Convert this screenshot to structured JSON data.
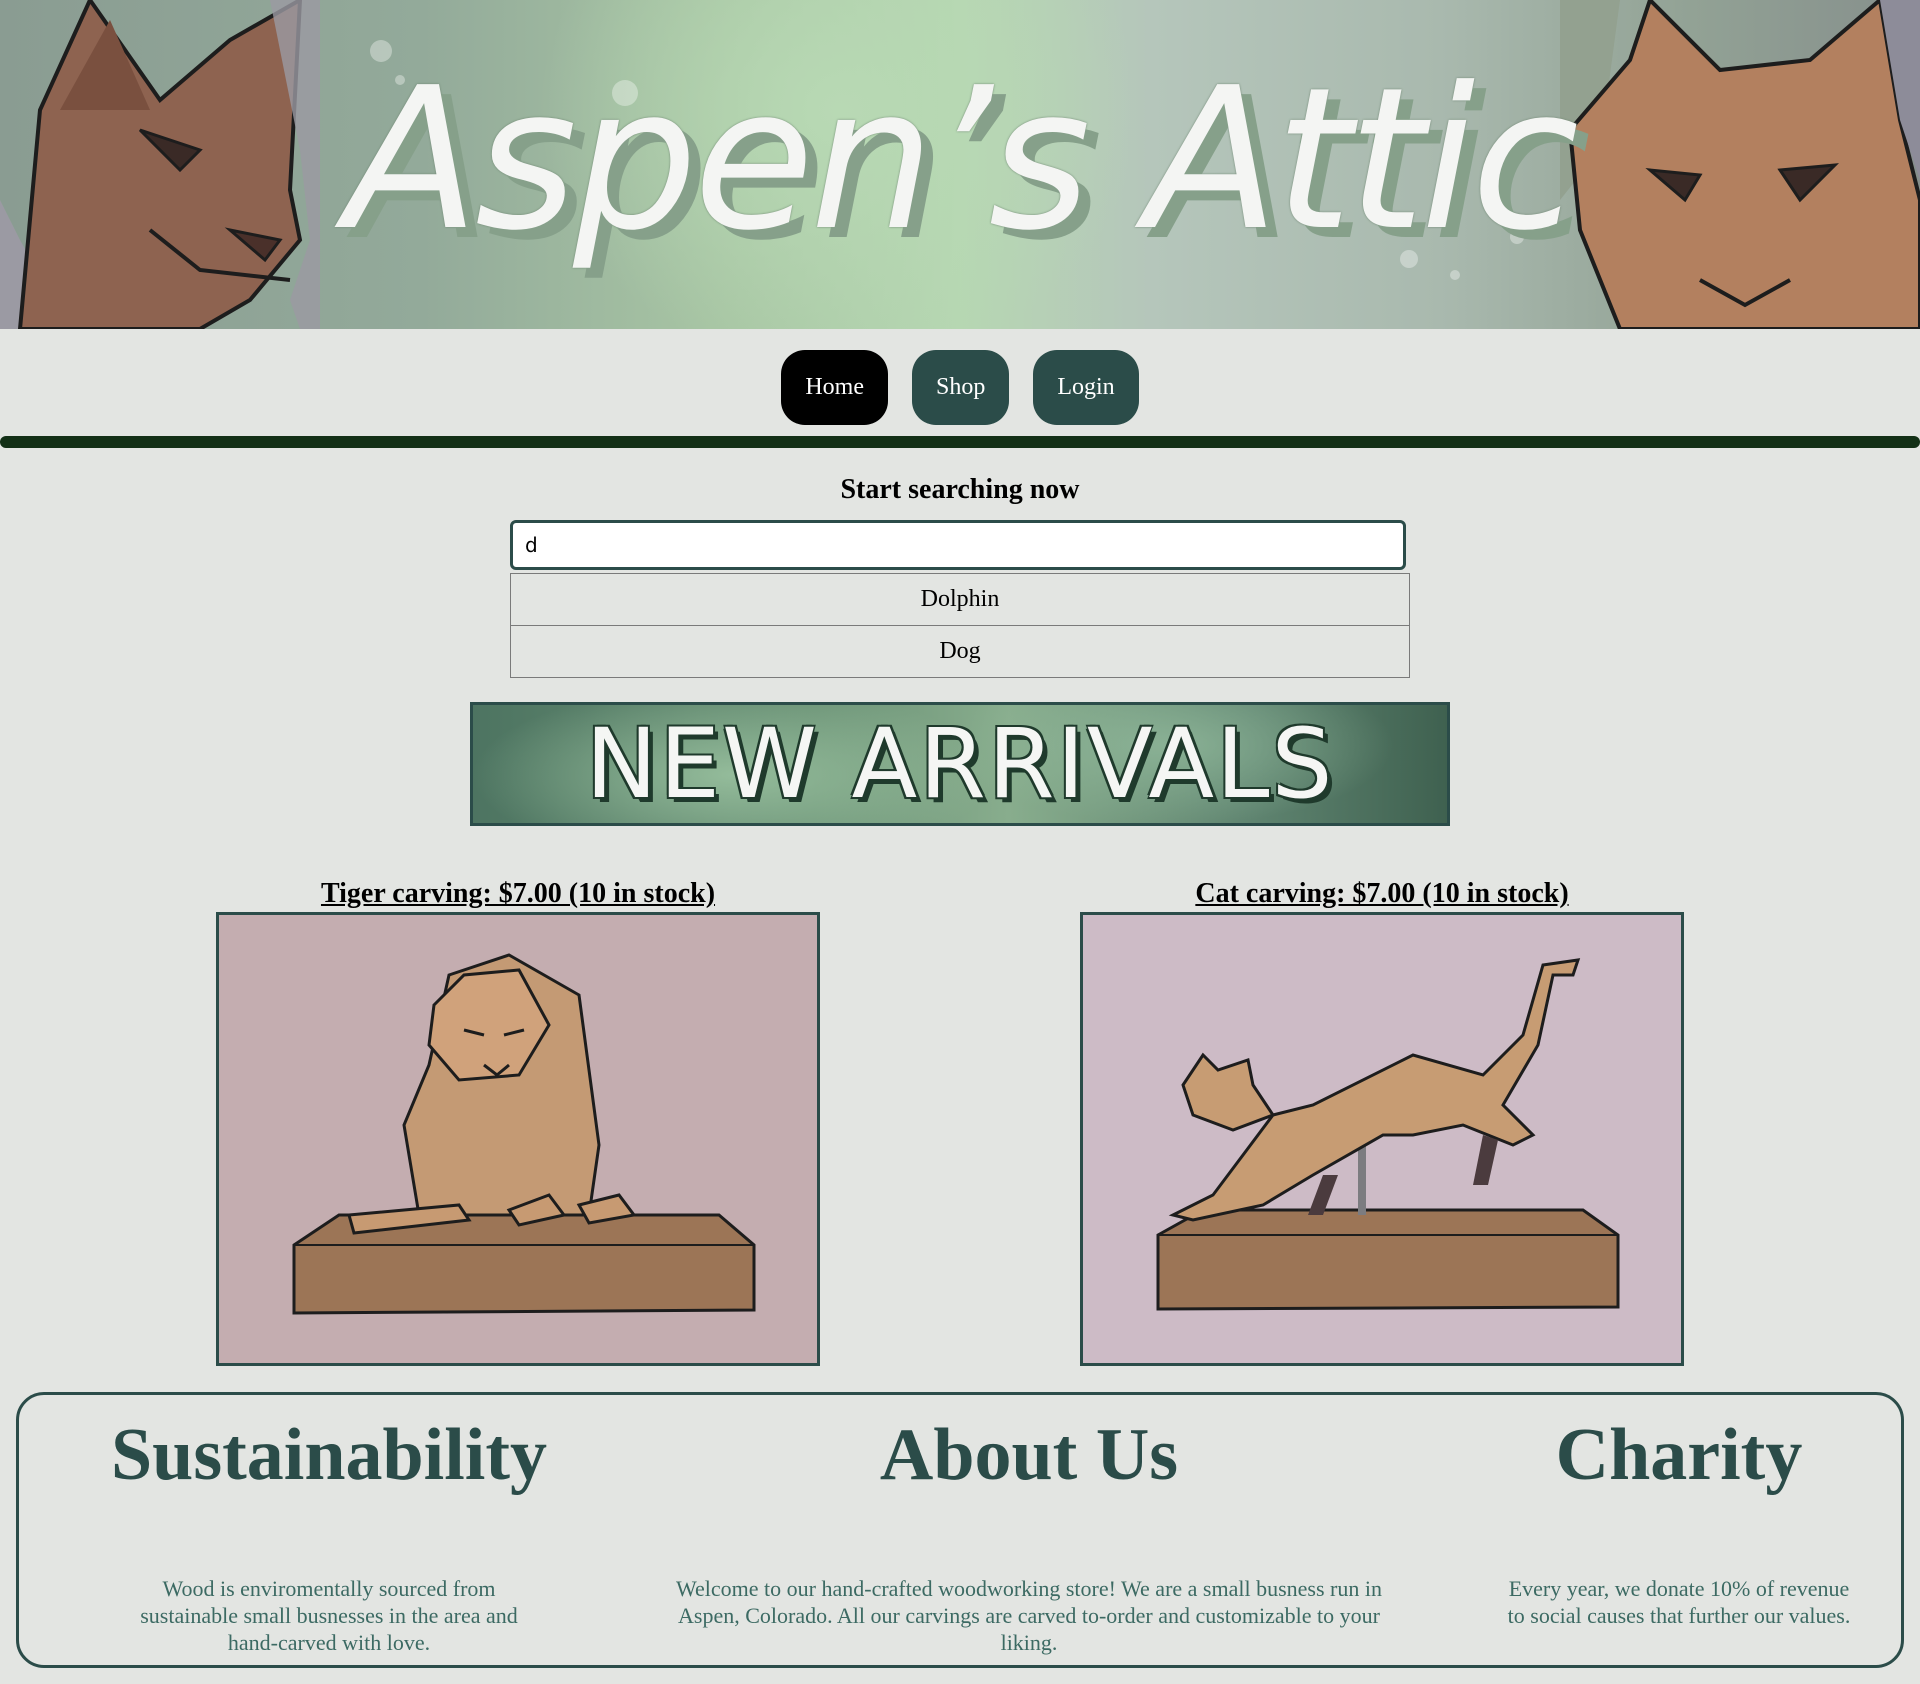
{
  "banner": {
    "title": "Aspen’s Attic",
    "left_art_icon": "cat-face-icon",
    "right_art_icon": "cat-face-icon"
  },
  "nav": {
    "items": [
      {
        "label": "Home",
        "active": true
      },
      {
        "label": "Shop",
        "active": false
      },
      {
        "label": "Login",
        "active": false
      }
    ]
  },
  "search": {
    "heading": "Start searching now",
    "value": "d",
    "suggestions": [
      "Dolphin",
      "Dog"
    ]
  },
  "new_arrivals": {
    "label": "NEW ARRIVALS"
  },
  "products": [
    {
      "title": "Tiger carving: $7.00 (10 in stock)",
      "image_icon": "tiger-carving-icon"
    },
    {
      "title": "Cat carving: $7.00 (10 in stock)",
      "image_icon": "cat-carving-icon"
    }
  ],
  "info": {
    "sustainability": {
      "heading": "Sustainability",
      "text": "Wood is enviromentally sourced from sustainable small busnesses in the area and hand-carved with love."
    },
    "about": {
      "heading": "About Us",
      "text": "Welcome to our hand-crafted woodworking store! We are a small busness run in Aspen, Colorado. All our carvings are carved to-order and customizable to your liking."
    },
    "charity": {
      "heading": "Charity",
      "text": "Every year, we donate 10% of revenue to social causes that further our values."
    }
  },
  "colors": {
    "page_bg": "#e3e5e2",
    "nav_button": "#2b4c49",
    "nav_active": "#000000",
    "rule": "#133016",
    "heading_green": "#2b4c49"
  }
}
